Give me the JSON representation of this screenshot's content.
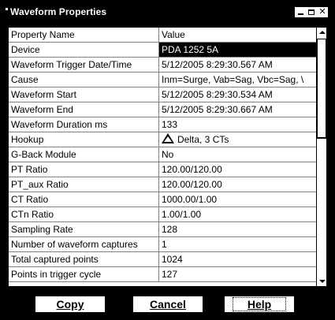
{
  "window": {
    "title": "Waveform Properties"
  },
  "header": {
    "name": "Property Name",
    "value": "Value"
  },
  "rows": [
    {
      "name": "Device",
      "value": "PDA 1252 5A",
      "selected": true
    },
    {
      "name": "Waveform Trigger Date/Time",
      "value": "5/12/2005 8:29:30.567 AM"
    },
    {
      "name": "Cause",
      "value": "Inm=Surge, Vab=Sag, Vbc=Sag, \\"
    },
    {
      "name": "Waveform Start",
      "value": "5/12/2005 8:29:30.534 AM"
    },
    {
      "name": "Waveform End",
      "value": "5/12/2005 8:29:30.667 AM"
    },
    {
      "name": "Waveform Duration ms",
      "value": "133"
    },
    {
      "name": "Hookup",
      "value": "Delta, 3 CTs",
      "icon": "delta-triangle-icon"
    },
    {
      "name": "G-Back Module",
      "value": "No"
    },
    {
      "name": "PT Ratio",
      "value": "120.00/120.00"
    },
    {
      "name": "PT_aux Ratio",
      "value": "120.00/120.00"
    },
    {
      "name": "CT Ratio",
      "value": "1000.00/1.00"
    },
    {
      "name": "CTn Ratio",
      "value": "1.00/1.00"
    },
    {
      "name": "Sampling Rate",
      "value": "128"
    },
    {
      "name": "Number of waveform captures",
      "value": "1"
    },
    {
      "name": "Total captured points",
      "value": "1024"
    },
    {
      "name": "Points in trigger cycle",
      "value": "127"
    }
  ],
  "buttons": {
    "copy": "Copy",
    "cancel": "Cancel",
    "help": "Help"
  },
  "icons": {
    "minimize": "minimize-icon",
    "maximize": "maximize-icon",
    "close": "close-icon",
    "scroll_up": "scroll-up-arrow-icon",
    "scroll_down": "scroll-down-arrow-icon"
  },
  "colors": {
    "background": "#000000",
    "text": "#000000",
    "grid": "#808080",
    "selection": "#000000"
  }
}
